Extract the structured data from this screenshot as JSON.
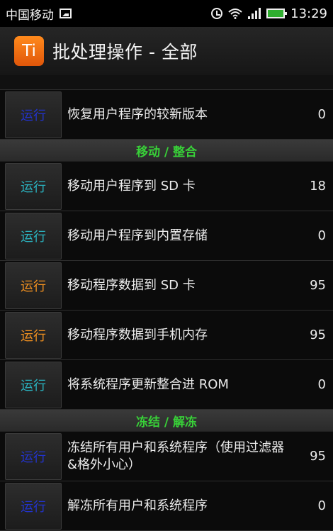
{
  "status_bar": {
    "carrier": "中国移动",
    "time": "13:29",
    "icons": [
      "image-icon",
      "alarm-icon",
      "wifi-icon",
      "signal-icon",
      "battery-icon"
    ]
  },
  "header": {
    "app_icon_text": "Ti",
    "title": "批处理操作 - 全部"
  },
  "colors": {
    "blue_run": "#2233cc",
    "teal_run": "#2ab3c0",
    "orange_run": "#f09020",
    "section_green": "#38d038"
  },
  "list": {
    "row_restore": {
      "run_label": "运行",
      "text": "恢复用户程序的较新版本",
      "count": "0",
      "run_color": "blue"
    },
    "section_move": {
      "title": "移动 / 整合"
    },
    "row_move_sd": {
      "run_label": "运行",
      "text": "移动用户程序到 SD 卡",
      "count": "18",
      "run_color": "teal"
    },
    "row_move_internal": {
      "run_label": "运行",
      "text": "移动用户程序到内置存储",
      "count": "0",
      "run_color": "teal"
    },
    "row_move_data_sd": {
      "run_label": "运行",
      "text": "移动程序数据到 SD 卡",
      "count": "95",
      "run_color": "orange"
    },
    "row_move_data_phone": {
      "run_label": "运行",
      "text": "移动程序数据到手机内存",
      "count": "95",
      "run_color": "orange"
    },
    "row_integrate_rom": {
      "run_label": "运行",
      "text": "将系统程序更新整合进 ROM",
      "count": "0",
      "run_color": "teal"
    },
    "section_freeze": {
      "title": "冻结 / 解冻"
    },
    "row_freeze_all": {
      "run_label": "运行",
      "text": "冻结所有用户和系统程序（使用过滤器&格外小心）",
      "count": "95",
      "run_color": "blue"
    },
    "row_unfreeze_all": {
      "run_label": "运行",
      "text": "解冻所有用户和系统程序",
      "count": "0",
      "run_color": "blue"
    }
  }
}
